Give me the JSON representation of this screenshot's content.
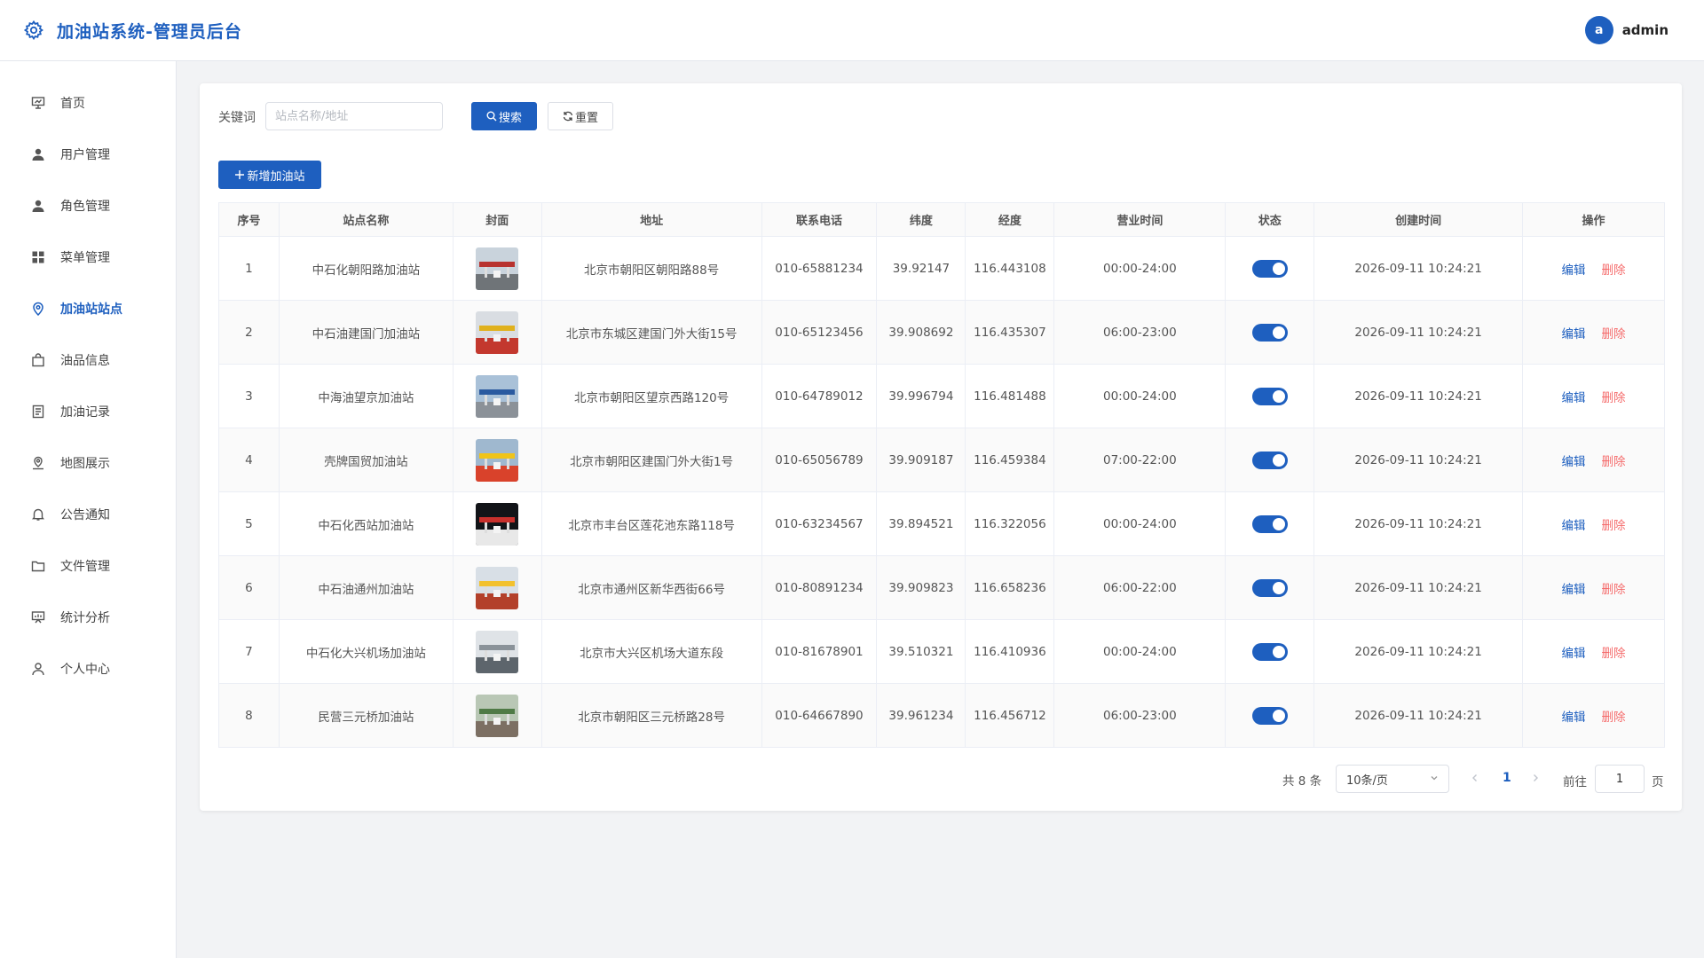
{
  "header": {
    "title": "加油站系统-管理员后台",
    "brand_icon": "gear-icon",
    "user": {
      "avatar_letter": "a",
      "name": "admin"
    }
  },
  "sidebar": {
    "items": [
      {
        "label": "首页",
        "icon": "presentation-icon",
        "active": false
      },
      {
        "label": "用户管理",
        "icon": "user-icon",
        "active": false
      },
      {
        "label": "角色管理",
        "icon": "user-icon",
        "active": false
      },
      {
        "label": "菜单管理",
        "icon": "grid-icon",
        "active": false
      },
      {
        "label": "加油站站点",
        "icon": "location-icon",
        "active": true
      },
      {
        "label": "油品信息",
        "icon": "bag-icon",
        "active": false
      },
      {
        "label": "加油记录",
        "icon": "document-icon",
        "active": false
      },
      {
        "label": "地图展示",
        "icon": "map-pin-icon",
        "active": false
      },
      {
        "label": "公告通知",
        "icon": "bell-icon",
        "active": false
      },
      {
        "label": "文件管理",
        "icon": "folder-icon",
        "active": false
      },
      {
        "label": "统计分析",
        "icon": "chart-board-icon",
        "active": false
      },
      {
        "label": "个人中心",
        "icon": "person-outline-icon",
        "active": false
      }
    ]
  },
  "search": {
    "label": "关键词",
    "placeholder": "站点名称/地址",
    "value": "",
    "search_button": "搜索",
    "reset_button": "重置",
    "add_button": "新增加油站"
  },
  "table": {
    "columns": [
      "序号",
      "站点名称",
      "封面",
      "地址",
      "联系电话",
      "纬度",
      "经度",
      "营业时间",
      "状态",
      "创建时间",
      "操作"
    ],
    "edit_label": "编辑",
    "delete_label": "删除",
    "rows": [
      {
        "index": "1",
        "name": "中石化朝阳路加油站",
        "address": "北京市朝阳区朝阳路88号",
        "phone": "010-65881234",
        "lat": "39.92147",
        "lng": "116.443108",
        "hours": "00:00-24:00",
        "enabled": true,
        "created": "2026-09-11 10:24:21",
        "cover_colors": [
          "#c9d3dc",
          "#b8332f",
          "#6f7478"
        ]
      },
      {
        "index": "2",
        "name": "中石油建国门加油站",
        "address": "北京市东城区建国门外大街15号",
        "phone": "010-65123456",
        "lat": "39.908692",
        "lng": "116.435307",
        "hours": "06:00-23:00",
        "enabled": true,
        "created": "2026-09-11 10:24:21",
        "cover_colors": [
          "#d9dde2",
          "#e0b11c",
          "#c3382e"
        ]
      },
      {
        "index": "3",
        "name": "中海油望京加油站",
        "address": "北京市朝阳区望京西路120号",
        "phone": "010-64789012",
        "lat": "39.996794",
        "lng": "116.481488",
        "hours": "00:00-24:00",
        "enabled": true,
        "created": "2026-09-11 10:24:21",
        "cover_colors": [
          "#a9c1d8",
          "#2a5aa0",
          "#8b9198"
        ]
      },
      {
        "index": "4",
        "name": "壳牌国贸加油站",
        "address": "北京市朝阳区建国门外大街1号",
        "phone": "010-65056789",
        "lat": "39.909187",
        "lng": "116.459384",
        "hours": "07:00-22:00",
        "enabled": true,
        "created": "2026-09-11 10:24:21",
        "cover_colors": [
          "#9fb8cf",
          "#f0c419",
          "#d9422b"
        ]
      },
      {
        "index": "5",
        "name": "中石化西站加油站",
        "address": "北京市丰台区莲花池东路118号",
        "phone": "010-63234567",
        "lat": "39.894521",
        "lng": "116.322056",
        "hours": "00:00-24:00",
        "enabled": true,
        "created": "2026-09-11 10:24:21",
        "cover_colors": [
          "#121418",
          "#c8302c",
          "#e8e8e8"
        ]
      },
      {
        "index": "6",
        "name": "中石油通州加油站",
        "address": "北京市通州区新华西街66号",
        "phone": "010-80891234",
        "lat": "39.909823",
        "lng": "116.658236",
        "hours": "06:00-22:00",
        "enabled": true,
        "created": "2026-09-11 10:24:21",
        "cover_colors": [
          "#d8dfe6",
          "#f2c12e",
          "#b3402a"
        ]
      },
      {
        "index": "7",
        "name": "中石化大兴机场加油站",
        "address": "北京市大兴区机场大道东段",
        "phone": "010-81678901",
        "lat": "39.510321",
        "lng": "116.410936",
        "hours": "00:00-24:00",
        "enabled": true,
        "created": "2026-09-11 10:24:21",
        "cover_colors": [
          "#dfe3e7",
          "#8a9299",
          "#5d656c"
        ]
      },
      {
        "index": "8",
        "name": "民营三元桥加油站",
        "address": "北京市朝阳区三元桥路28号",
        "phone": "010-64667890",
        "lat": "39.961234",
        "lng": "116.456712",
        "hours": "06:00-23:00",
        "enabled": true,
        "created": "2026-09-11 10:24:21",
        "cover_colors": [
          "#b9c7b5",
          "#4f7a46",
          "#7c6f63"
        ]
      }
    ]
  },
  "pagination": {
    "total": "共 8 条",
    "page_size": "10条/页",
    "current_page": "1",
    "goto_label": "前往",
    "goto_value": "1",
    "goto_suffix": "页"
  },
  "colors": {
    "primary": "#1e5fbf",
    "danger": "#f56c6c"
  }
}
